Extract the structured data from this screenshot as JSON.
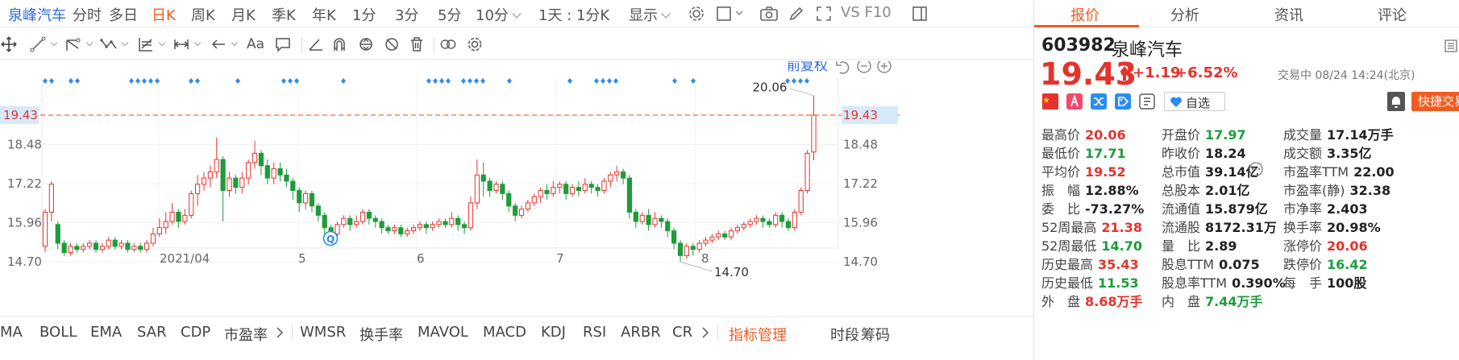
{
  "period_bar": {
    "items": [
      "泉峰汽车",
      "分时",
      "多日",
      "日K",
      "周K",
      "月K",
      "季K",
      "年K",
      "1分",
      "3分",
      "5分",
      "10分",
      "1天 : 1分K",
      "显示",
      "VS F10"
    ],
    "active": "日K"
  },
  "tool_bar": {
    "font_label": "Aa"
  },
  "chart": {
    "right_label": "前复权",
    "price_line_label": "19.43",
    "max_label": "20.06",
    "min_label": "14.70",
    "marker_label": "Q",
    "colors": {
      "up": "#e4332c",
      "down": "#1c9d3a",
      "price_line": "#f25b1f",
      "markers": "#2d8cf0",
      "price_box": "#d6e9fb"
    }
  },
  "chart_data": {
    "type": "candlestick",
    "x_ticks": [
      "2021/04",
      "5",
      "6",
      "7",
      "8"
    ],
    "y_ticks": [
      "18.48",
      "17.22",
      "15.96",
      "14.70"
    ],
    "ylim": [
      13.3,
      19.74
    ],
    "last_price": 19.43,
    "high": 20.06,
    "low": 14.7,
    "candles": [
      [
        15.2,
        16.3,
        15.0,
        16.4
      ],
      [
        16.3,
        17.2,
        16.0,
        17.3
      ],
      [
        15.9,
        15.3,
        15.1,
        16.0
      ],
      [
        15.3,
        15.0,
        14.9,
        15.4
      ],
      [
        15.0,
        15.2,
        14.9,
        15.3
      ],
      [
        15.2,
        15.1,
        15.0,
        15.3
      ],
      [
        15.1,
        15.2,
        15.0,
        15.3
      ],
      [
        15.2,
        15.3,
        15.1,
        15.4
      ],
      [
        15.3,
        15.1,
        15.0,
        15.4
      ],
      [
        15.1,
        15.2,
        15.0,
        15.3
      ],
      [
        15.2,
        15.4,
        15.1,
        15.5
      ],
      [
        15.4,
        15.2,
        15.1,
        15.5
      ],
      [
        15.2,
        15.3,
        15.1,
        15.4
      ],
      [
        15.3,
        15.1,
        15.0,
        15.4
      ],
      [
        15.1,
        15.2,
        15.0,
        15.3
      ],
      [
        15.2,
        15.1,
        15.0,
        15.3
      ],
      [
        15.1,
        15.3,
        15.0,
        15.4
      ],
      [
        15.3,
        15.6,
        15.2,
        15.8
      ],
      [
        15.6,
        15.8,
        15.5,
        16.1
      ],
      [
        15.8,
        16.0,
        15.6,
        16.3
      ],
      [
        16.0,
        16.3,
        15.9,
        16.6
      ],
      [
        16.3,
        16.0,
        15.8,
        16.4
      ],
      [
        16.0,
        16.2,
        15.9,
        16.4
      ],
      [
        16.2,
        16.9,
        16.1,
        17.0
      ],
      [
        16.9,
        17.2,
        16.5,
        17.5
      ],
      [
        17.2,
        17.4,
        17.0,
        17.6
      ],
      [
        17.4,
        17.6,
        17.1,
        17.8
      ],
      [
        17.6,
        18.0,
        17.4,
        18.7
      ],
      [
        18.0,
        17.0,
        16.0,
        18.1
      ],
      [
        17.0,
        17.4,
        16.8,
        17.6
      ],
      [
        17.4,
        17.1,
        16.9,
        17.5
      ],
      [
        17.1,
        17.4,
        16.9,
        17.6
      ],
      [
        17.4,
        17.9,
        17.2,
        18.0
      ],
      [
        17.9,
        18.2,
        17.7,
        18.6
      ],
      [
        18.2,
        17.8,
        17.5,
        18.3
      ],
      [
        17.8,
        17.4,
        17.2,
        18.0
      ],
      [
        17.4,
        17.7,
        17.2,
        17.9
      ],
      [
        17.7,
        17.5,
        17.3,
        17.9
      ],
      [
        17.5,
        17.3,
        17.1,
        17.7
      ],
      [
        17.3,
        17.0,
        16.7,
        17.4
      ],
      [
        17.0,
        16.6,
        16.3,
        17.1
      ],
      [
        16.6,
        16.9,
        16.4,
        17.0
      ],
      [
        16.9,
        16.5,
        16.3,
        17.0
      ],
      [
        16.5,
        16.2,
        16.0,
        16.6
      ],
      [
        16.2,
        15.8,
        15.6,
        16.3
      ],
      [
        15.8,
        15.6,
        15.5,
        15.9
      ],
      [
        15.6,
        15.9,
        15.5,
        16.0
      ],
      [
        15.9,
        16.1,
        15.8,
        16.2
      ],
      [
        16.1,
        15.9,
        15.7,
        16.2
      ],
      [
        15.9,
        16.0,
        15.8,
        16.2
      ],
      [
        16.0,
        16.3,
        15.9,
        16.4
      ],
      [
        16.3,
        16.1,
        15.9,
        16.4
      ],
      [
        16.1,
        16.0,
        15.8,
        16.2
      ],
      [
        16.0,
        15.8,
        15.6,
        16.1
      ],
      [
        15.8,
        15.7,
        15.6,
        15.9
      ],
      [
        15.7,
        15.8,
        15.6,
        15.9
      ],
      [
        15.8,
        15.6,
        15.5,
        15.9
      ],
      [
        15.6,
        15.7,
        15.5,
        15.8
      ],
      [
        15.7,
        15.8,
        15.6,
        15.9
      ],
      [
        15.8,
        15.9,
        15.7,
        16.0
      ],
      [
        15.9,
        15.8,
        15.6,
        16.0
      ],
      [
        15.8,
        15.9,
        15.7,
        16.0
      ],
      [
        15.9,
        16.0,
        15.8,
        16.1
      ],
      [
        16.0,
        15.9,
        15.8,
        16.1
      ],
      [
        15.9,
        16.1,
        15.8,
        16.3
      ],
      [
        16.1,
        15.9,
        15.7,
        16.2
      ],
      [
        15.9,
        15.8,
        15.6,
        16.0
      ],
      [
        15.8,
        16.6,
        15.7,
        16.8
      ],
      [
        16.6,
        17.5,
        16.4,
        18.0
      ],
      [
        17.5,
        17.3,
        16.8,
        17.9
      ],
      [
        17.3,
        17.0,
        16.8,
        17.4
      ],
      [
        17.0,
        17.2,
        16.9,
        17.3
      ],
      [
        17.2,
        16.9,
        16.7,
        17.3
      ],
      [
        16.9,
        16.5,
        16.3,
        17.0
      ],
      [
        16.5,
        16.2,
        16.0,
        16.6
      ],
      [
        16.2,
        16.4,
        16.1,
        16.5
      ],
      [
        16.4,
        16.6,
        16.3,
        16.7
      ],
      [
        16.6,
        16.8,
        16.5,
        16.9
      ],
      [
        16.8,
        17.0,
        16.6,
        17.1
      ],
      [
        17.0,
        16.9,
        16.7,
        17.2
      ],
      [
        16.9,
        17.1,
        16.8,
        17.3
      ],
      [
        17.1,
        17.2,
        16.9,
        17.3
      ],
      [
        17.2,
        16.9,
        16.7,
        17.3
      ],
      [
        16.9,
        17.1,
        16.8,
        17.2
      ],
      [
        17.1,
        17.0,
        16.8,
        17.3
      ],
      [
        17.0,
        17.2,
        16.9,
        17.4
      ],
      [
        17.2,
        17.1,
        16.9,
        17.3
      ],
      [
        17.1,
        17.0,
        16.8,
        17.2
      ],
      [
        17.0,
        17.3,
        16.9,
        17.4
      ],
      [
        17.3,
        17.5,
        17.1,
        17.6
      ],
      [
        17.5,
        17.6,
        17.3,
        17.8
      ],
      [
        17.6,
        17.4,
        17.2,
        17.7
      ],
      [
        17.4,
        16.3,
        16.1,
        17.5
      ],
      [
        16.3,
        16.0,
        15.8,
        16.4
      ],
      [
        16.0,
        16.2,
        15.9,
        16.3
      ],
      [
        16.2,
        15.9,
        15.7,
        16.4
      ],
      [
        15.9,
        16.1,
        15.8,
        16.3
      ],
      [
        16.1,
        16.0,
        15.8,
        16.2
      ],
      [
        16.0,
        15.7,
        15.5,
        16.1
      ],
      [
        15.7,
        15.3,
        15.1,
        15.8
      ],
      [
        15.3,
        14.9,
        14.7,
        15.4
      ],
      [
        14.9,
        15.2,
        14.8,
        15.3
      ],
      [
        15.2,
        15.1,
        14.9,
        15.3
      ],
      [
        15.1,
        15.3,
        15.0,
        15.4
      ],
      [
        15.3,
        15.4,
        15.2,
        15.5
      ],
      [
        15.4,
        15.5,
        15.3,
        15.6
      ],
      [
        15.5,
        15.6,
        15.4,
        15.7
      ],
      [
        15.6,
        15.5,
        15.4,
        15.7
      ],
      [
        15.5,
        15.7,
        15.4,
        15.8
      ],
      [
        15.7,
        15.8,
        15.6,
        15.9
      ],
      [
        15.8,
        15.9,
        15.7,
        16.0
      ],
      [
        15.9,
        16.0,
        15.8,
        16.1
      ],
      [
        16.0,
        16.1,
        15.9,
        16.2
      ],
      [
        16.1,
        16.0,
        15.8,
        16.2
      ],
      [
        16.0,
        15.9,
        15.8,
        16.1
      ],
      [
        15.9,
        16.2,
        15.8,
        16.3
      ],
      [
        16.2,
        16.0,
        15.8,
        16.3
      ],
      [
        16.0,
        15.8,
        15.7,
        16.1
      ],
      [
        15.8,
        16.3,
        15.7,
        16.4
      ],
      [
        16.3,
        17.0,
        16.2,
        17.1
      ],
      [
        17.0,
        18.2,
        16.9,
        18.3
      ],
      [
        18.24,
        19.43,
        17.97,
        20.06
      ]
    ]
  },
  "indicators": {
    "items": [
      "MA",
      "BOLL",
      "EMA",
      "SAR",
      "CDP",
      "市盈率",
      "WMSR",
      "换手率",
      "MAVOL",
      "MACD",
      "KDJ",
      "RSI",
      "ARBR",
      "CR",
      "指标管理",
      "时段",
      "筹码"
    ],
    "accent": "指标管理"
  },
  "quote": {
    "tabs": [
      "报价",
      "分析",
      "资讯",
      "评论"
    ],
    "active_tab": "报价",
    "code": "603982",
    "name": "泉峰汽车",
    "price": "19.43",
    "change": "+1.19",
    "change_pct": "+6.52%",
    "status": "交易中 08/24 14:24(北京)",
    "watch_label": "自选",
    "trade_label": "快捷交易",
    "rows": [
      [
        [
          "最高价",
          "20.06",
          "red"
        ],
        [
          "开盘价",
          "17.97",
          "green"
        ],
        [
          "成交量",
          "17.14万手",
          "dark"
        ]
      ],
      [
        [
          "最低价",
          "17.71",
          "green"
        ],
        [
          "昨收价",
          "18.24",
          "dark"
        ],
        [
          "成交额",
          "3.35亿",
          "dark"
        ]
      ],
      [
        [
          "平均价",
          "19.52",
          "red"
        ],
        [
          "总市值",
          "39.14亿",
          "dark"
        ],
        [
          "市盈率TTM",
          "22.00",
          "dark"
        ]
      ],
      [
        [
          "振　幅",
          "12.88%",
          "dark"
        ],
        [
          "总股本",
          "2.01亿",
          "dark"
        ],
        [
          "市盈率(静)",
          "32.38",
          "dark"
        ]
      ],
      [
        [
          "委　比",
          "-73.27%",
          "dark"
        ],
        [
          "流通值",
          "15.879亿",
          "dark"
        ],
        [
          "市净率",
          "2.403",
          "dark"
        ]
      ],
      [
        [
          "52周最高",
          "21.38",
          "red"
        ],
        [
          "流通股",
          "8172.31万",
          "dark"
        ],
        [
          "换手率",
          "20.98%",
          "dark"
        ]
      ],
      [
        [
          "52周最低",
          "14.70",
          "green"
        ],
        [
          "量　比",
          "2.89",
          "dark"
        ],
        [
          "涨停价",
          "20.06",
          "red"
        ]
      ],
      [
        [
          "历史最高",
          "35.43",
          "red"
        ],
        [
          "股息TTM",
          "0.075",
          "dark"
        ],
        [
          "跌停价",
          "16.42",
          "green"
        ]
      ],
      [
        [
          "历史最低",
          "11.53",
          "green"
        ],
        [
          "股息率TTM",
          "0.390%",
          "dark"
        ],
        [
          "每　手",
          "100股",
          "dark"
        ]
      ],
      [
        [
          "外　盘",
          "8.68万手",
          "red"
        ],
        [
          "内　盘",
          "7.44万手",
          "green"
        ]
      ]
    ]
  }
}
